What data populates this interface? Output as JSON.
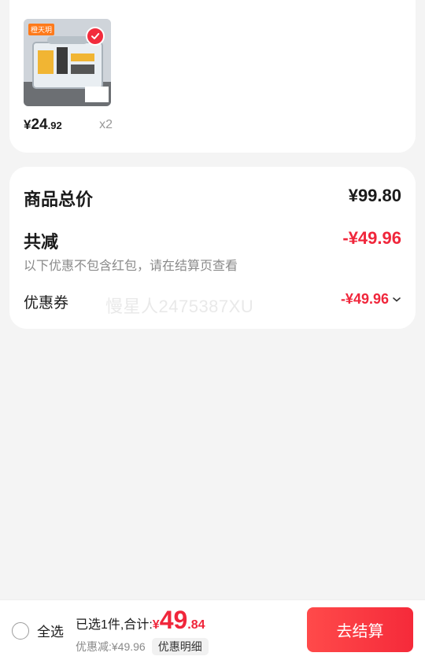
{
  "product": {
    "brand_tag": "橙天玥",
    "price_symbol": "¥",
    "price_int": "24",
    "price_dec": ".92",
    "quantity": "x2",
    "selected": true
  },
  "summary": {
    "total_label": "商品总价",
    "total_value": "¥99.80",
    "reduction_label": "共减",
    "reduction_value": "-¥49.96",
    "note": "以下优惠不包含红包，请在结算页查看",
    "coupon_label": "优惠券",
    "coupon_value": "-¥49.96"
  },
  "watermark": "慢星人2475387XU",
  "bottom_bar": {
    "select_all_label": "全选",
    "selected_summary": "已选1件,合计:",
    "total_symbol": "¥",
    "total_int": "49",
    "total_dec": ".84",
    "discount_text": "优惠减:¥49.96",
    "detail_label": "优惠明细",
    "checkout_label": "去结算"
  },
  "colors": {
    "accent_red": "#f0263b",
    "background": "#f4f4f4"
  }
}
